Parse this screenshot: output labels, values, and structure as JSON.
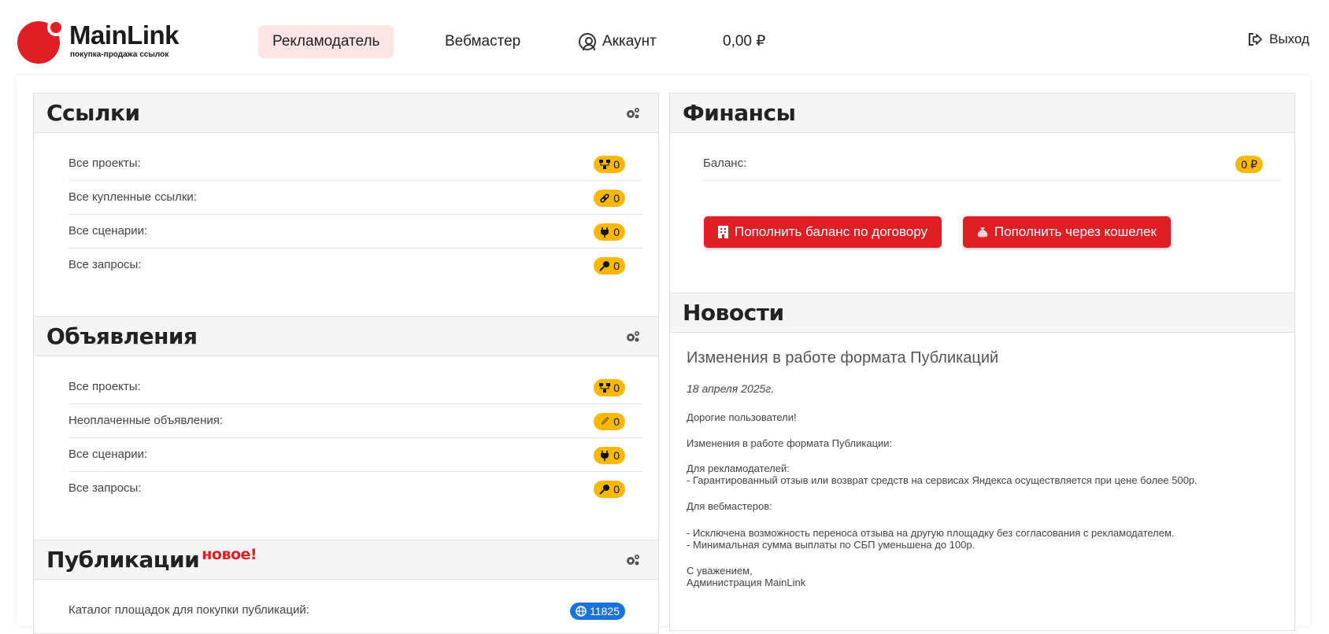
{
  "header": {
    "logo_name": "MainLink",
    "logo_tagline": "покупка-продажа ссылок",
    "nav": {
      "advertiser": "Рекламодатель",
      "webmaster": "Вебмастер",
      "account": "Аккаунт",
      "balance": "0,00 ₽"
    },
    "logout": "Выход"
  },
  "links_panel": {
    "title": "Ссылки",
    "rows": [
      {
        "label": "Все проекты:",
        "count": "0",
        "icon": "sitemap-icon"
      },
      {
        "label": "Все купленные ссылки:",
        "count": "0",
        "icon": "link-icon"
      },
      {
        "label": "Все сценарии:",
        "count": "0",
        "icon": "plug-icon"
      },
      {
        "label": "Все запросы:",
        "count": "0",
        "icon": "key-icon"
      }
    ]
  },
  "ads_panel": {
    "title": "Объявления",
    "rows": [
      {
        "label": "Все проекты:",
        "count": "0",
        "icon": "sitemap-icon"
      },
      {
        "label": "Неоплаченные объявления:",
        "count": "0",
        "icon": "paperclip-icon"
      },
      {
        "label": "Все сценарии:",
        "count": "0",
        "icon": "plug-icon"
      },
      {
        "label": "Все запросы:",
        "count": "0",
        "icon": "key-icon"
      }
    ]
  },
  "publications_panel": {
    "title": "Публикации",
    "new_badge": "новое!",
    "rows": [
      {
        "label": "Каталог площадок для покупки публикаций:",
        "count": "11825",
        "icon": "globe-icon"
      }
    ]
  },
  "finance_panel": {
    "title": "Финансы",
    "balance_label": "Баланс:",
    "balance_value": "0 ₽",
    "btn_contract": "Пополнить баланс по договору",
    "btn_wallet": "Пополнить через кошелек"
  },
  "news_panel": {
    "title": "Новости",
    "article_title": "Изменения в работе формата Публикаций",
    "date": "18 апреля 2025г.",
    "p1": "Дорогие пользователи!",
    "p2": "Изменения в работе формата Публикации:",
    "p3a": "Для рекламодателей:",
    "p3b": "- Гарантированный отзыв или возврат средств на сервисах Яндекса осуществляется при цене более 500р.",
    "p4": "Для вебмастеров:",
    "p5a": "- Исключена возможность переноса отзыва на другую площадку без согласования с рекламодателем.",
    "p5b": "- Минимальная сумма выплаты по СБП уменьшена до 100р.",
    "p6a": "С уважением,",
    "p6b": "Администрация MainLink"
  },
  "colors": {
    "brand_red": "#e01e26",
    "pill_yellow": "#f9b800",
    "pill_blue": "#1a73d9",
    "nav_active_bg": "#fde4e5"
  }
}
